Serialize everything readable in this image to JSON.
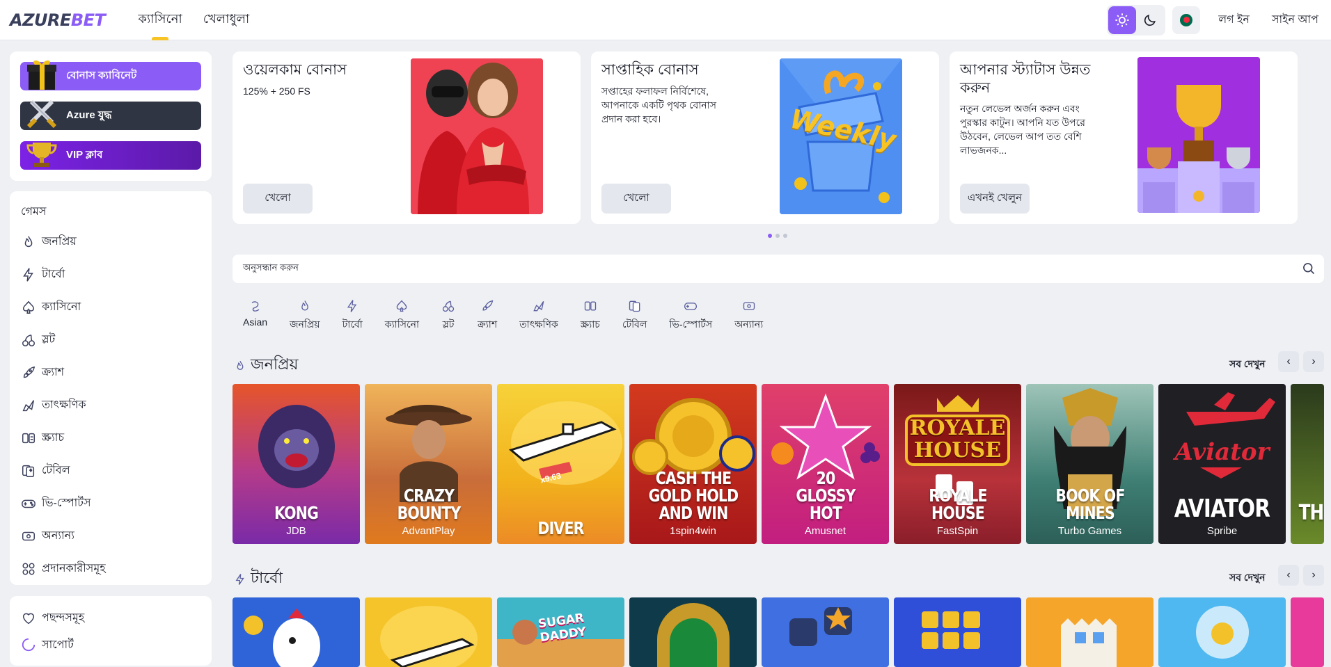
{
  "header": {
    "logo_a": "AZURE",
    "logo_b": "BET",
    "nav": [
      "ক্যাসিনো",
      "খেলাধুলা"
    ],
    "login": "লগ ইন",
    "signup": "সাইন আপ",
    "accent": "#8b5cf6"
  },
  "bonus_buttons": [
    {
      "label": "বোনাস ক্যাবিনেট",
      "color": "#8b5cf6"
    },
    {
      "label": "Azure যুদ্ধ",
      "color": "#2f3543"
    },
    {
      "label": "VIP ক্লাব",
      "color": "#6d28d9"
    }
  ],
  "sidebar": {
    "games_title": "গেমস",
    "items": [
      "জনপ্রিয়",
      "টার্বো",
      "ক্যাসিনো",
      "স্লট",
      "ক্র্যাশ",
      "তাৎক্ষণিক",
      "স্ক্র্যাচ",
      "টেবিল",
      "ভি-স্পোর্টস",
      "অন্যান্য",
      "প্রদানকারীসমূহ"
    ],
    "bottom": [
      "পছন্দসমূহ",
      "সাপোর্ট"
    ]
  },
  "promos": [
    {
      "title": "ওয়েলকাম বোনাস",
      "desc": "125% + 250 FS",
      "button": "খেলো"
    },
    {
      "title": "সাপ্তাহিক বোনাস",
      "desc": "সপ্তাহের ফলাফল নির্বিশেষে, আপনাকে একটি পৃথক বোনাস প্রদান করা হবে।",
      "button": "খেলো",
      "image_text": "Weekly"
    },
    {
      "title": "আপনার স্ট্যাটাস উন্নত করুন",
      "desc": "নতুন লেভেল অর্জন করুন এবং পুরস্কার কাটুন। আপনি যত উপরে উঠবেন, লেভেল আপ তত বেশি লাভজনক...",
      "button": "এখনই খেলুন"
    }
  ],
  "search": {
    "placeholder": "অনুসন্ধান করুন"
  },
  "categories": [
    "Asian",
    "জনপ্রিয়",
    "টার্বো",
    "ক্যাসিনো",
    "স্লট",
    "ক্র্যাশ",
    "তাৎক্ষণিক",
    "স্ক্র্যাচ",
    "টেবিল",
    "ভি-স্পোর্টস",
    "অন্যান্য"
  ],
  "popular": {
    "title": "জনপ্রিয়",
    "see_all": "সব দেখুন",
    "games": [
      {
        "name": "KONG",
        "provider": "JDB"
      },
      {
        "name": "CRAZY BOUNTY",
        "provider": "AdvantPlay"
      },
      {
        "name": "DIVER",
        "provider": "",
        "badge": "x9.63"
      },
      {
        "name": "CASH THE GOLD HOLD AND WIN",
        "provider": "1spin4win"
      },
      {
        "name": "20 GLOSSY HOT",
        "provider": "Amusnet"
      },
      {
        "name": "ROYALE HOUSE",
        "provider": "FastSpin",
        "logo": "ROYALE HOUSE"
      },
      {
        "name": "BOOK OF MINES",
        "provider": "Turbo Games"
      },
      {
        "name": "AVIATOR",
        "provider": "Spribe",
        "logo": "Aviator"
      },
      {
        "name": "TH",
        "provider": ""
      }
    ]
  },
  "turbo": {
    "title": "টার্বো",
    "see_all": "সব দেখুন",
    "tile_text": [
      "SUGAR DADDY"
    ]
  }
}
